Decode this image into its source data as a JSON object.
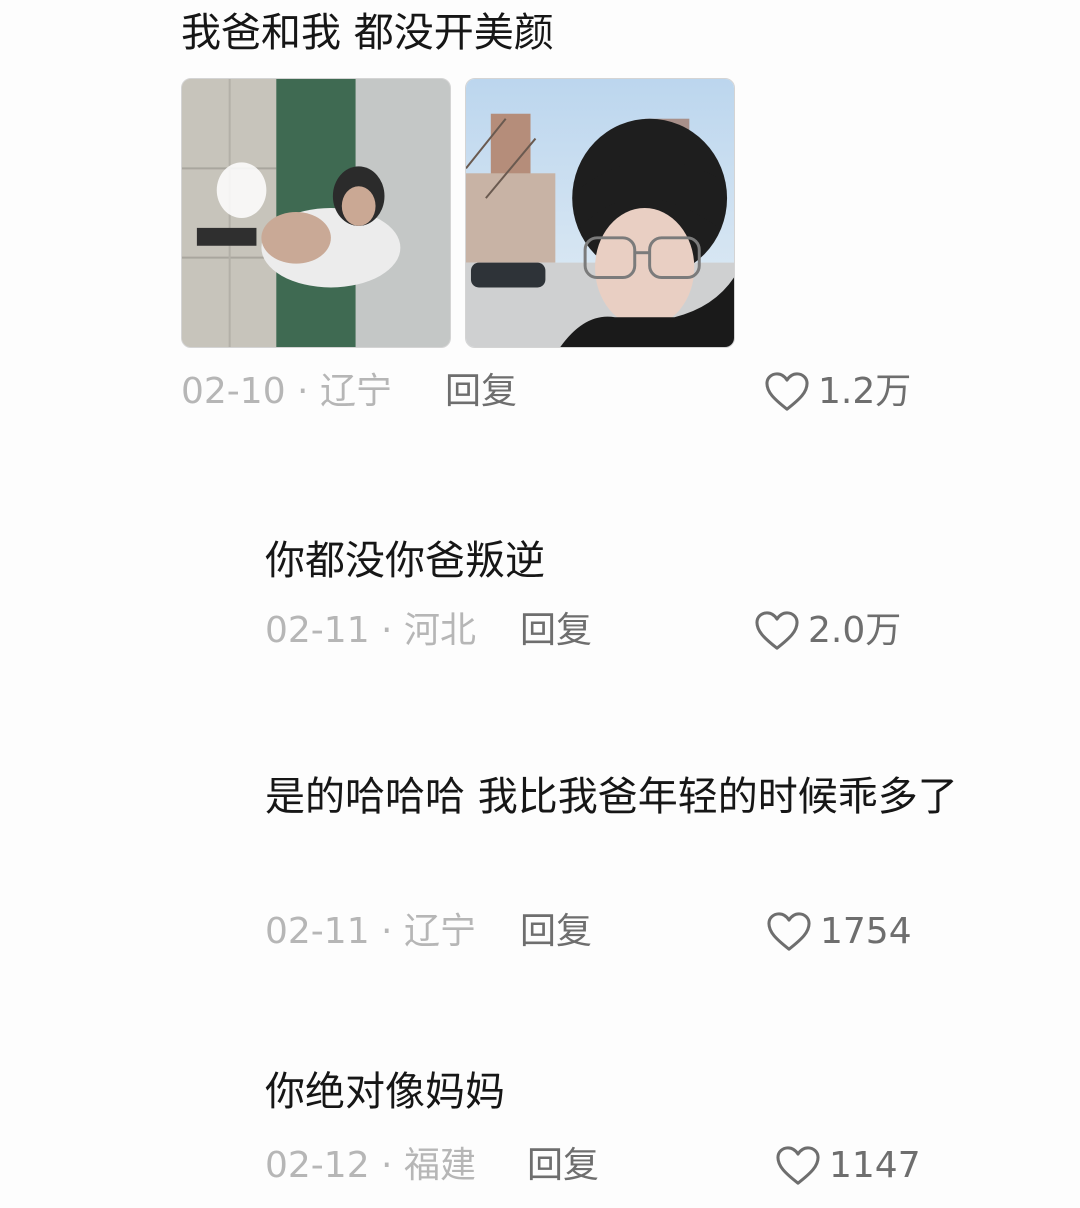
{
  "comments": [
    {
      "text": "我爸和我 都没开美颜",
      "date_location": "02-10 · 辽宁",
      "reply_label": "回复",
      "likes": "1.2万",
      "images": [
        {
          "icon": "old-photo-father"
        },
        {
          "icon": "selfie-photo-son"
        }
      ]
    },
    {
      "text": "你都没你爸叛逆",
      "date_location": "02-11 · 河北",
      "reply_label": "回复",
      "likes": "2.0万"
    },
    {
      "text": "是的哈哈哈 我比我爸年轻的时候乖多了",
      "date_location": "02-11 · 辽宁",
      "reply_label": "回复",
      "likes": "1754"
    },
    {
      "text": "你绝对像妈妈",
      "date_location": "02-12 · 福建",
      "reply_label": "回复",
      "likes": "1147"
    }
  ],
  "icons": {
    "like": "heart-outline-icon"
  },
  "colors": {
    "text": "#161616",
    "meta": "#b6b6b6",
    "action": "#6e6e6e"
  }
}
